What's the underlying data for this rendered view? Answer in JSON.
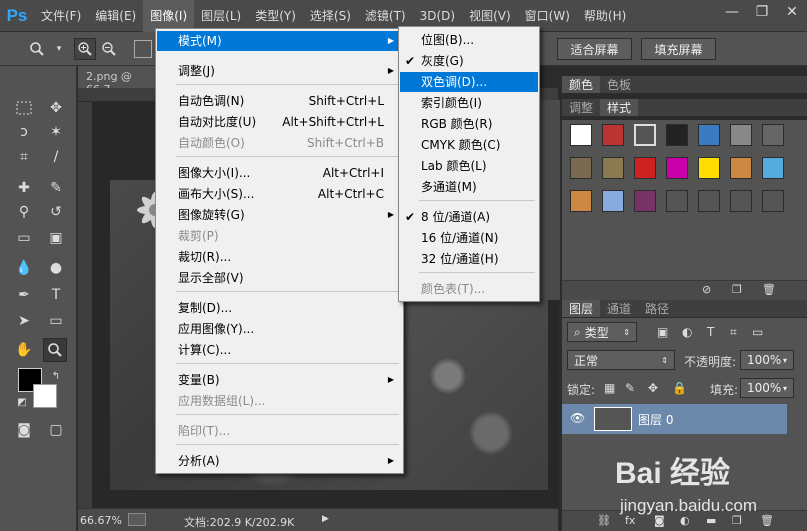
{
  "app": {
    "logo": "Ps"
  },
  "menubar": {
    "items": [
      "文件(F)",
      "编辑(E)",
      "图像(I)",
      "图层(L)",
      "类型(Y)",
      "选择(S)",
      "滤镜(T)",
      "3D(D)",
      "视图(V)",
      "窗口(W)",
      "帮助(H)"
    ],
    "active_index": 2
  },
  "window": {
    "minimize": "—",
    "restore": "❐",
    "close": "✕"
  },
  "options_bar": {
    "fit_screen": "适合屏幕",
    "fill_screen": "填充屏幕"
  },
  "document": {
    "tab_title": "2.png @ 66.7",
    "status_zoom": "66.67%",
    "status_doc": "文档:202.9 K/202.9K"
  },
  "image_menu": {
    "items": [
      {
        "label": "模式(M)",
        "submenu": true,
        "highlight": true
      },
      {
        "label": "调整(J)",
        "submenu": true
      },
      {
        "label": "自动色调(N)",
        "shortcut": "Shift+Ctrl+L"
      },
      {
        "label": "自动对比度(U)",
        "shortcut": "Alt+Shift+Ctrl+L"
      },
      {
        "label": "自动颜色(O)",
        "shortcut": "Shift+Ctrl+B",
        "disabled": true
      },
      {
        "label": "图像大小(I)...",
        "shortcut": "Alt+Ctrl+I"
      },
      {
        "label": "画布大小(S)...",
        "shortcut": "Alt+Ctrl+C"
      },
      {
        "label": "图像旋转(G)",
        "submenu": true
      },
      {
        "label": "裁剪(P)",
        "disabled": true
      },
      {
        "label": "裁切(R)..."
      },
      {
        "label": "显示全部(V)"
      },
      {
        "label": "复制(D)..."
      },
      {
        "label": "应用图像(Y)..."
      },
      {
        "label": "计算(C)..."
      },
      {
        "label": "变量(B)",
        "submenu": true
      },
      {
        "label": "应用数据组(L)...",
        "disabled": true
      },
      {
        "label": "陷印(T)...",
        "disabled": true
      },
      {
        "label": "分析(A)",
        "submenu": true
      }
    ]
  },
  "mode_submenu": {
    "items": [
      {
        "label": "位图(B)..."
      },
      {
        "label": "灰度(G)",
        "checked": true
      },
      {
        "label": "双色调(D)...",
        "highlight": true
      },
      {
        "label": "索引颜色(I)"
      },
      {
        "label": "RGB 颜色(R)"
      },
      {
        "label": "CMYK 颜色(C)"
      },
      {
        "label": "Lab 颜色(L)"
      },
      {
        "label": "多通道(M)"
      },
      {
        "label": "8 位/通道(A)",
        "checked": true
      },
      {
        "label": "16 位/通道(N)"
      },
      {
        "label": "32 位/通道(H)"
      },
      {
        "label": "颜色表(T)...",
        "disabled": true
      }
    ]
  },
  "right_panels": {
    "color_tabs": [
      "颜色",
      "色板"
    ],
    "adjust_tabs": [
      "调整",
      "样式"
    ],
    "layers_tabs": [
      "图层",
      "通道",
      "路径"
    ],
    "filter_kind": "类型",
    "blend_mode": "正常",
    "opacity_label": "不透明度:",
    "opacity_value": "100%",
    "lock_label": "锁定:",
    "fill_label": "填充:",
    "fill_value": "100%",
    "layer_name": "图层 0"
  },
  "watermark": {
    "logo": "Bai 经验",
    "url": "jingyan.baidu.com"
  }
}
